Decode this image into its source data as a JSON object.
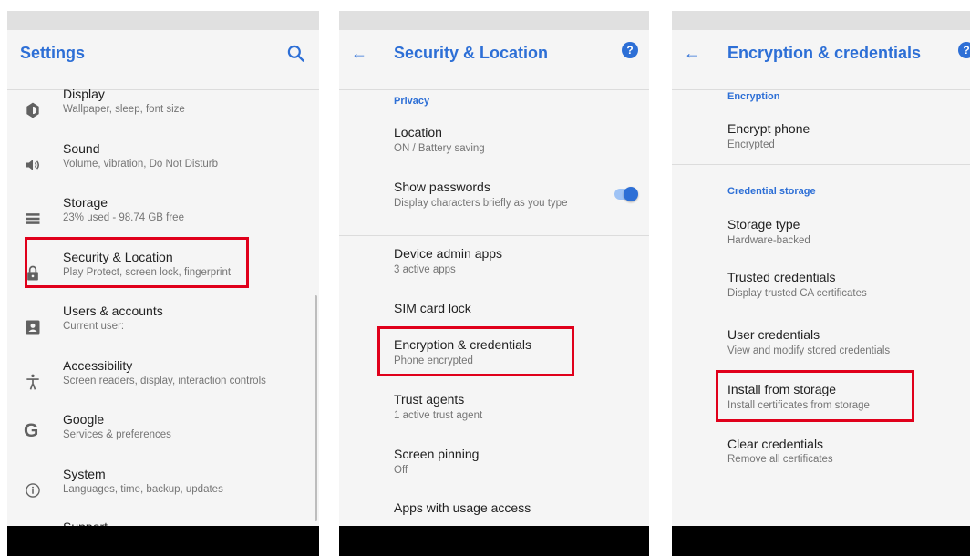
{
  "panel1": {
    "title": "Settings",
    "items": [
      {
        "title": "Display",
        "subtitle": "Wallpaper, sleep, font size",
        "icon": "brightness-icon"
      },
      {
        "title": "Sound",
        "subtitle": "Volume, vibration, Do Not Disturb",
        "icon": "volume-icon"
      },
      {
        "title": "Storage",
        "subtitle": "23% used - 98.74 GB free",
        "icon": "storage-icon"
      },
      {
        "title": "Security & Location",
        "subtitle": "Play Protect, screen lock, fingerprint",
        "icon": "lock-icon"
      },
      {
        "title": "Users & accounts",
        "subtitle": "Current user:",
        "icon": "account-icon"
      },
      {
        "title": "Accessibility",
        "subtitle": "Screen readers, display, interaction controls",
        "icon": "accessibility-icon"
      },
      {
        "title": "Google",
        "subtitle": "Services & preferences",
        "icon": "google-icon"
      },
      {
        "title": "System",
        "subtitle": "Languages, time, backup, updates",
        "icon": "info-icon"
      },
      {
        "title": "Support",
        "subtitle": "",
        "icon": ""
      }
    ]
  },
  "panel2": {
    "title": "Security & Location",
    "section": "Privacy",
    "items": [
      {
        "title": "Location",
        "subtitle": "ON / Battery saving"
      },
      {
        "title": "Show passwords",
        "subtitle": "Display characters briefly as you type",
        "toggle_on": true
      },
      {
        "title": "Device admin apps",
        "subtitle": "3 active apps"
      },
      {
        "title": "SIM card lock",
        "subtitle": ""
      },
      {
        "title": "Encryption & credentials",
        "subtitle": "Phone encrypted"
      },
      {
        "title": "Trust agents",
        "subtitle": "1 active trust agent"
      },
      {
        "title": "Screen pinning",
        "subtitle": "Off"
      },
      {
        "title": "Apps with usage access",
        "subtitle": ""
      }
    ]
  },
  "panel3": {
    "title": "Encryption & credentials",
    "sections": [
      "Encryption",
      "Credential storage"
    ],
    "items": [
      {
        "title": "Encrypt phone",
        "subtitle": "Encrypted"
      },
      {
        "title": "Storage type",
        "subtitle": "Hardware-backed"
      },
      {
        "title": "Trusted credentials",
        "subtitle": "Display trusted CA certificates"
      },
      {
        "title": "User credentials",
        "subtitle": "View and modify stored credentials"
      },
      {
        "title": "Install from storage",
        "subtitle": "Install certificates from storage"
      },
      {
        "title": "Clear credentials",
        "subtitle": "Remove all certificates"
      }
    ]
  },
  "colors": {
    "accent": "#2d6fd6",
    "highlight": "#e0001b",
    "background": "#f5f5f5"
  }
}
